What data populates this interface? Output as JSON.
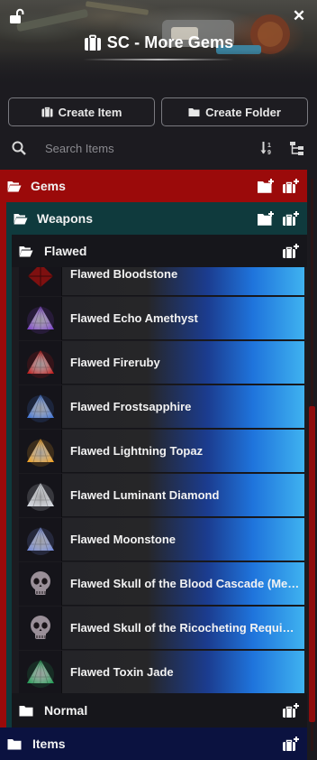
{
  "header": {
    "title": "SC - More Gems",
    "lock_icon": "unlock-icon",
    "close_icon": "close-icon",
    "close_glyph": "✕"
  },
  "toolbar": {
    "create_item_label": "Create Item",
    "create_folder_label": "Create Folder"
  },
  "search": {
    "placeholder": "Search Items",
    "value": ""
  },
  "tree": {
    "root_folder": {
      "label": "Gems",
      "color": "#9b0a0a"
    },
    "sub_folder": {
      "label": "Weapons",
      "color": "#0f3a3d"
    },
    "open_folder": {
      "label": "Flawed"
    },
    "items": [
      {
        "name": "Flawed Bloodstone",
        "gem": "bloodstone",
        "color": "#8a1010"
      },
      {
        "name": "Flawed Echo Amethyst",
        "gem": "amethyst",
        "color": "#7a3fc9"
      },
      {
        "name": "Flawed Fireruby",
        "gem": "ruby",
        "color": "#c01818"
      },
      {
        "name": "Flawed Frostsapphire",
        "gem": "sapphire",
        "color": "#3d72d6"
      },
      {
        "name": "Flawed Lightning Topaz",
        "gem": "topaz",
        "color": "#f0a020"
      },
      {
        "name": "Flawed Luminant Diamond",
        "gem": "diamond",
        "color": "#d8dce4"
      },
      {
        "name": "Flawed Moonstone",
        "gem": "moonstone",
        "color": "#6f86d8"
      },
      {
        "name": "Flawed Skull of the Blood Cascade (Melee)",
        "gem": "skull",
        "color": "#9a8f98"
      },
      {
        "name": "Flawed Skull of the Ricocheting Requiem (Ranged)",
        "gem": "skull",
        "color": "#9a8f98"
      },
      {
        "name": "Flawed Toxin Jade",
        "gem": "jade",
        "color": "#1f9a52"
      }
    ],
    "closed_folder": {
      "label": "Normal"
    },
    "bottom_folder": {
      "label": "Items",
      "color": "#0b1240"
    }
  }
}
